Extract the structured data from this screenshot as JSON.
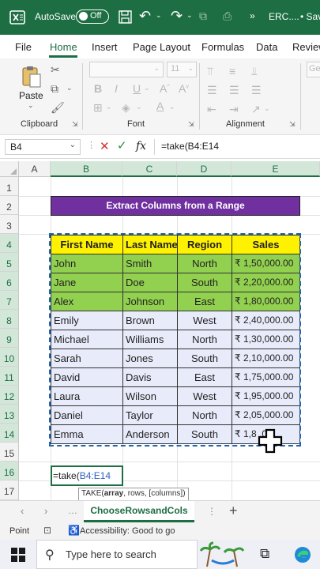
{
  "titlebar": {
    "autosave_label": "AutoSave",
    "autosave_state": "Off",
    "filename": "ERC....",
    "save_status": "• Sav"
  },
  "ribbon_tabs": [
    "File",
    "Home",
    "Insert",
    "Page Layout",
    "Formulas",
    "Data",
    "Review"
  ],
  "active_tab": "Home",
  "ribbon": {
    "paste_label": "Paste",
    "groups": [
      "Clipboard",
      "Font",
      "Alignment"
    ],
    "font_size": "11"
  },
  "formula_bar": {
    "name_box": "B4",
    "fx": "fx",
    "formula": "=take(B4:E14"
  },
  "columns": [
    "A",
    "B",
    "C",
    "D",
    "E"
  ],
  "rows": [
    "1",
    "2",
    "3",
    "4",
    "5",
    "6",
    "7",
    "8",
    "9",
    "10",
    "11",
    "12",
    "13",
    "14",
    "15",
    "16",
    "17"
  ],
  "sheet": {
    "title": "Extract Columns from a Range",
    "headers": [
      "First Name",
      "Last Name",
      "Region",
      "Sales"
    ],
    "data": [
      [
        "John",
        "Smith",
        "North",
        "₹ 1,50,000.00"
      ],
      [
        "Jane",
        "Doe",
        "South",
        "₹ 2,20,000.00"
      ],
      [
        "Alex",
        "Johnson",
        "East",
        "₹ 1,80,000.00"
      ],
      [
        "Emily",
        "Brown",
        "West",
        "₹ 2,40,000.00"
      ],
      [
        "Michael",
        "Williams",
        "North",
        "₹ 1,30,000.00"
      ],
      [
        "Sarah",
        "Jones",
        "South",
        "₹ 2,10,000.00"
      ],
      [
        "David",
        "Davis",
        "East",
        "₹ 1,75,000.00"
      ],
      [
        "Laura",
        "Wilson",
        "West",
        "₹ 1,95,000.00"
      ],
      [
        "Daniel",
        "Taylor",
        "North",
        "₹ 2,05,000.00"
      ],
      [
        "Emma",
        "Anderson",
        "South",
        "₹ 1,8     .00"
      ]
    ],
    "editing_cell_prefix": "=take(",
    "editing_cell_ref": "B4:E14",
    "tooltip_fn": "TAKE(",
    "tooltip_arg": "array",
    "tooltip_rest": ", rows, [columns])"
  },
  "sheet_tab": "ChooseRowsandCols",
  "status": {
    "mode": "Point",
    "accessibility": "Accessibility: Good to go"
  },
  "taskbar": {
    "search_placeholder": "Type here to search"
  },
  "colors": {
    "excel_green": "#1e6e43",
    "title_purple": "#7030a0",
    "header_yellow": "#fff200",
    "green_rows": "#92d050",
    "blue_rows": "#e8ecfa"
  }
}
